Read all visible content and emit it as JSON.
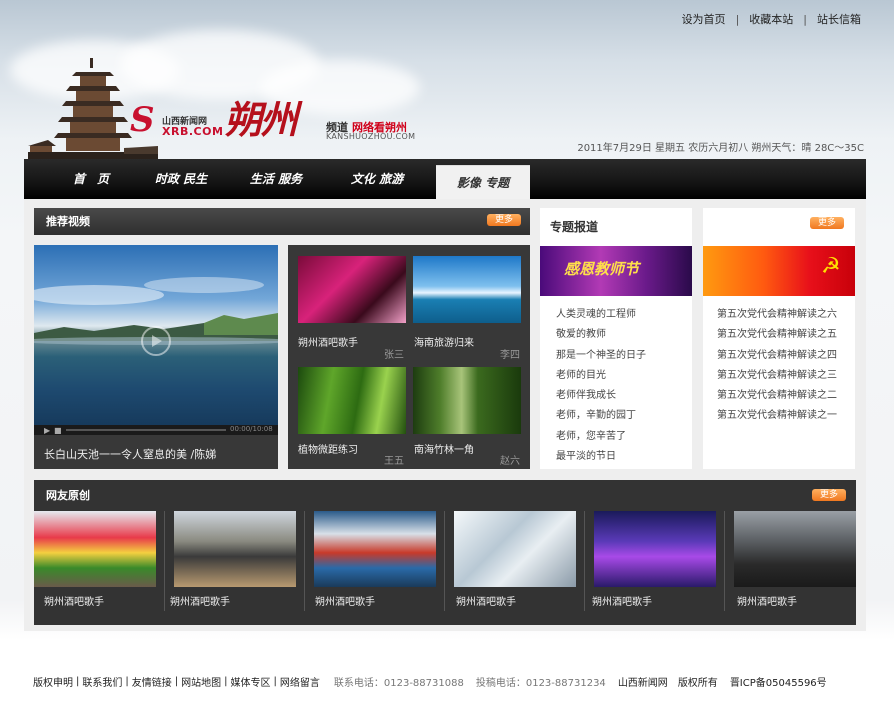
{
  "toplinks": {
    "home": "设为首页",
    "favorite": "收藏本站",
    "mail": "站长信箱",
    "sep": "|"
  },
  "logo": {
    "s_letter": "S",
    "site_cn": "山西新闻网",
    "site_en": "XRB.COM",
    "big": "朔州",
    "pindao": "频道",
    "slogan": "网络看朔州",
    "domain": "KANSHUOZHOU.COM"
  },
  "dateline": "2011年7月29日  星期五  农历六月初八  朔州天气：晴 28C～35C",
  "nav": [
    "首　页",
    "时政 民生",
    "生活 服务",
    "文化 旅游",
    "影像 专题"
  ],
  "nav_active": "影像 专题",
  "recommended": {
    "title": "推荐视频",
    "more": "更多",
    "video_caption": "长白山天池一一令人窒息的美 /陈娣",
    "video_time": "00:00/10:08",
    "thumbs": [
      {
        "title": "朔州酒吧歌手",
        "author": "张三"
      },
      {
        "title": "海南旅游归来",
        "author": "李四"
      },
      {
        "title": "植物微距练习",
        "author": "王五"
      },
      {
        "title": "南海竹林一角",
        "author": "赵六"
      }
    ]
  },
  "special": {
    "title": "专题报道",
    "banner_text": "感恩教师节",
    "items": [
      "人类灵魂的工程师",
      "敬爱的教师",
      "那是一个神圣的日子",
      "老师的目光",
      "老师伴我成长",
      "老师，辛勤的园丁",
      "老师，您辛苦了",
      "最平淡的节日"
    ]
  },
  "party": {
    "more": "更多",
    "items": [
      "第五次党代会精神解读之六",
      "第五次党代会精神解读之五",
      "第五次党代会精神解读之四",
      "第五次党代会精神解读之三",
      "第五次党代会精神解读之二",
      "第五次党代会精神解读之一"
    ]
  },
  "original": {
    "title": "网友原创",
    "more": "更多",
    "items": [
      "朔州酒吧歌手",
      "朔州酒吧歌手",
      "朔州酒吧歌手",
      "朔州酒吧歌手",
      "朔州酒吧歌手",
      "朔州酒吧歌手"
    ]
  },
  "footer": {
    "links": [
      "版权申明",
      "联系我们",
      "友情链接",
      "网站地图",
      "媒体专区",
      "网络留言"
    ],
    "sep": "|",
    "phone": "联系电话：0123-88731088",
    "submit_phone": "投稿电话：0123-88731234",
    "org": "山西新闻网",
    "rights": "版权所有",
    "icp": "晋ICP备05045596号"
  }
}
